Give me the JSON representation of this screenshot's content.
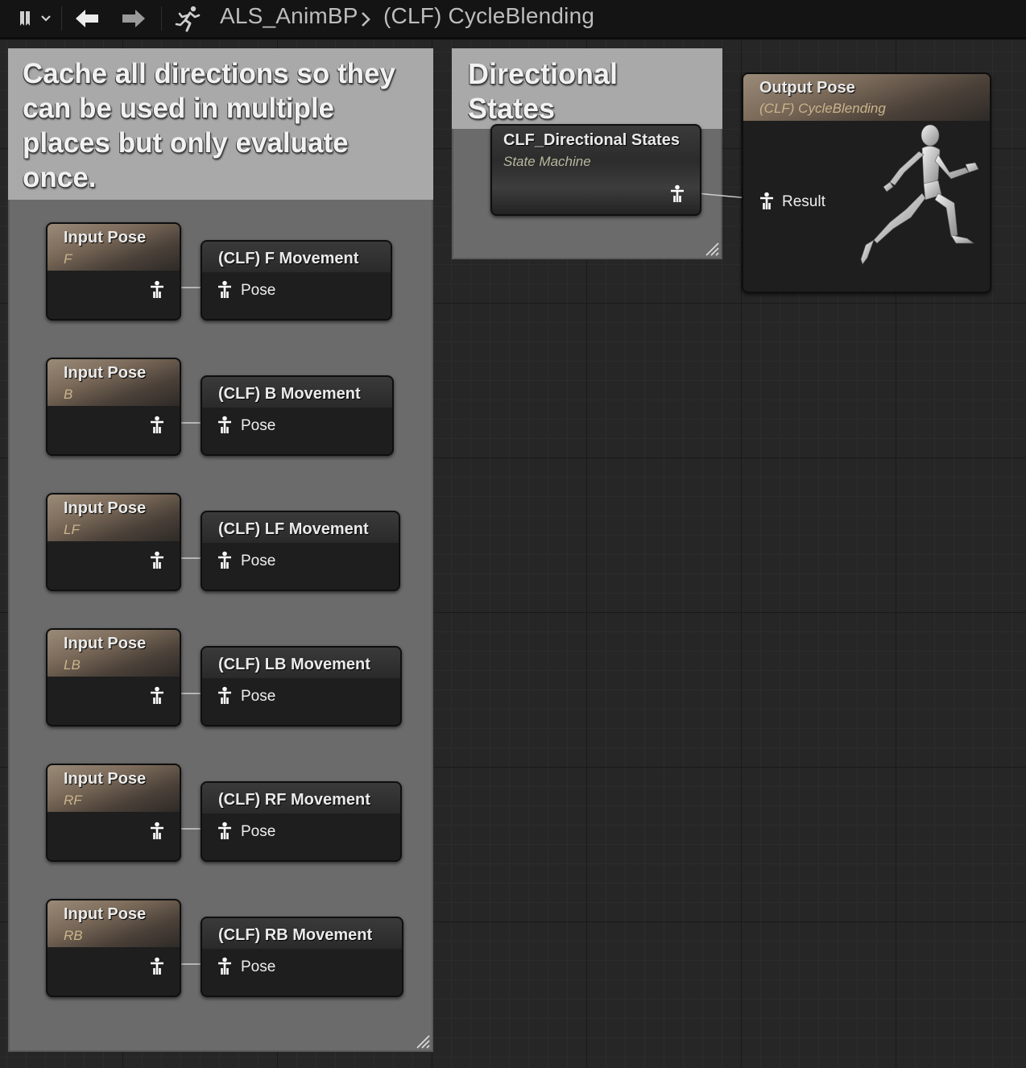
{
  "toolbar": {
    "bookmark_icon": "bookmark-icon",
    "back_icon": "arrow-left-icon",
    "forward_icon": "arrow-right-icon",
    "anim_icon": "running-figure-icon"
  },
  "breadcrumb": {
    "root": "ALS_AnimBP",
    "current": "(CLF) CycleBlending"
  },
  "comments": {
    "cache": "Cache all directions so they can be used in multiple places but only evaluate once.",
    "directional": "Directional States"
  },
  "input_poses": [
    {
      "title": "Input Pose",
      "sub": "F"
    },
    {
      "title": "Input Pose",
      "sub": "B"
    },
    {
      "title": "Input Pose",
      "sub": "LF"
    },
    {
      "title": "Input Pose",
      "sub": "LB"
    },
    {
      "title": "Input Pose",
      "sub": "RF"
    },
    {
      "title": "Input Pose",
      "sub": "RB"
    }
  ],
  "cache_nodes": [
    {
      "title": "(CLF) F Movement",
      "pin": "Pose"
    },
    {
      "title": "(CLF) B Movement",
      "pin": "Pose"
    },
    {
      "title": "(CLF) LF Movement",
      "pin": "Pose"
    },
    {
      "title": "(CLF) LB Movement",
      "pin": "Pose"
    },
    {
      "title": "(CLF) RF Movement",
      "pin": "Pose"
    },
    {
      "title": "(CLF) RB Movement",
      "pin": "Pose"
    }
  ],
  "state_machine": {
    "title": "CLF_Directional States",
    "sub": "State Machine"
  },
  "output_pose": {
    "title": "Output Pose",
    "sub": "(CLF) CycleBlending",
    "pin": "Result",
    "preview_icon": "mannequin-running-icon"
  },
  "colors": {
    "graph_bg": "#262626",
    "comment_bg": "#6b6b6b",
    "comment_title_bg": "#a9a9a9",
    "node_header_brown": "#7c6b5a",
    "subtitle_tan": "#c9b48c"
  }
}
